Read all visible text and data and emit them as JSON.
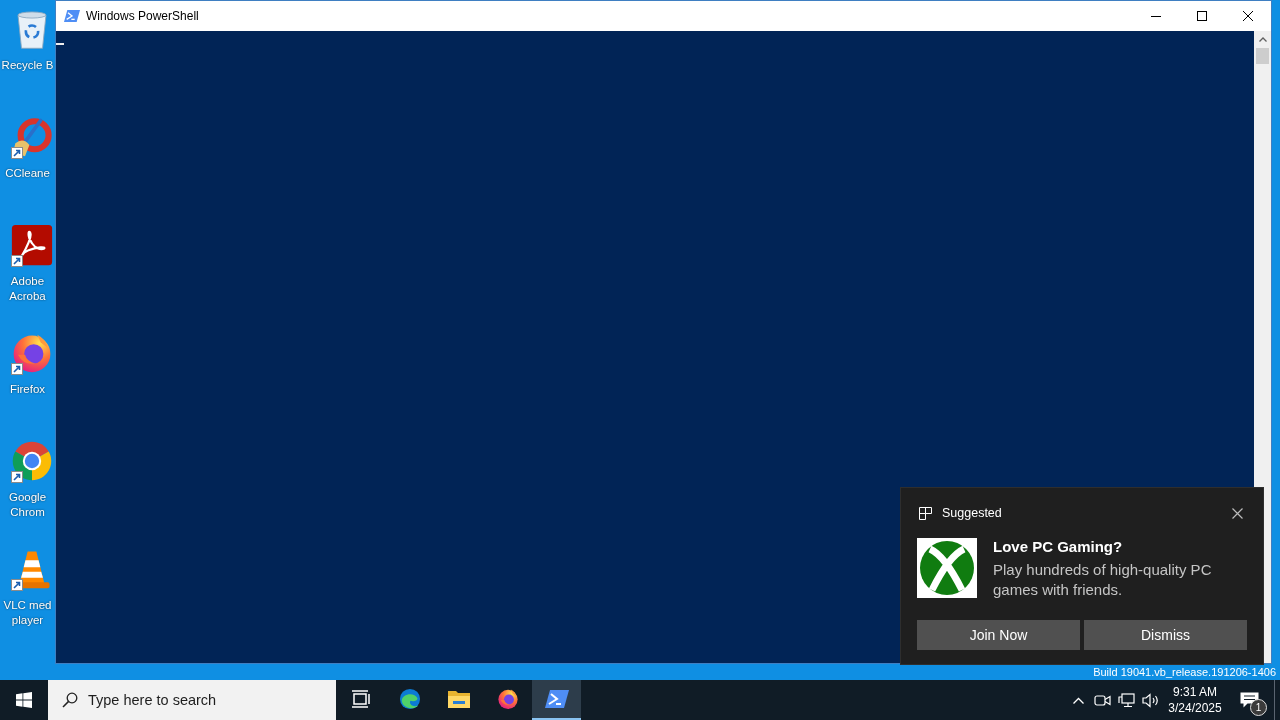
{
  "desktop": {
    "icons": [
      {
        "kind": "bin",
        "label_lines": [
          "Recycle B"
        ],
        "shortcut": false
      },
      {
        "kind": "broom",
        "label_lines": [
          "CCleane"
        ],
        "shortcut": true
      },
      {
        "kind": "swirl",
        "label_lines": [
          "Adobe",
          "Acroba"
        ],
        "shortcut": true
      },
      {
        "kind": "globe",
        "label_lines": [
          "Firefox"
        ],
        "shortcut": true
      },
      {
        "kind": "ring",
        "label_lines": [
          "Google",
          "Chrom"
        ],
        "shortcut": true
      },
      {
        "kind": "cone",
        "label_lines": [
          "VLC med",
          "player"
        ],
        "shortcut": true
      }
    ],
    "build_info": "Build 19041.vb_release.191206-1406"
  },
  "window": {
    "title": "Windows PowerShell"
  },
  "toast": {
    "header": "Suggested",
    "title": "Love PC Gaming?",
    "body": "Play hundreds of high-quality PC games with friends.",
    "buttons": [
      "Join Now",
      "Dismiss"
    ]
  },
  "taskbar": {
    "search": {
      "placeholder": "Type here to search"
    },
    "apps": [
      {
        "kind": "task-view",
        "selected": false
      },
      {
        "kind": "wave",
        "selected": false
      },
      {
        "kind": "folder",
        "selected": false
      },
      {
        "kind": "globe",
        "selected": false
      },
      {
        "kind": "terminal",
        "selected": true
      }
    ],
    "clock": {
      "time": "9:31 AM",
      "date": "3/24/2025"
    },
    "notifications": {
      "count": "1"
    }
  }
}
